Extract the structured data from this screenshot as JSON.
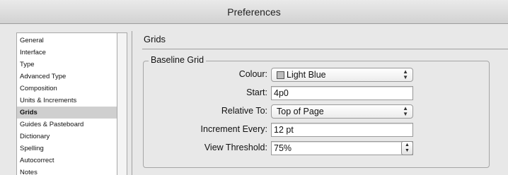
{
  "window": {
    "title": "Preferences"
  },
  "sidebar": {
    "items": [
      {
        "label": "General"
      },
      {
        "label": "Interface"
      },
      {
        "label": "Type"
      },
      {
        "label": "Advanced Type"
      },
      {
        "label": "Composition"
      },
      {
        "label": "Units & Increments"
      },
      {
        "label": "Grids",
        "selected": true
      },
      {
        "label": "Guides & Pasteboard"
      },
      {
        "label": "Dictionary"
      },
      {
        "label": "Spelling"
      },
      {
        "label": "Autocorrect"
      },
      {
        "label": "Notes"
      }
    ]
  },
  "main": {
    "section_title": "Grids",
    "group_title": "Baseline Grid",
    "colour": {
      "label": "Colour:",
      "value": "Light Blue",
      "swatch_color": "#bdbdbd"
    },
    "start": {
      "label": "Start:",
      "value": "4p0"
    },
    "relative_to": {
      "label": "Relative To:",
      "value": "Top of Page"
    },
    "increment_every": {
      "label": "Increment Every:",
      "value": "12 pt"
    },
    "view_threshold": {
      "label": "View Threshold:",
      "value": "75%"
    }
  }
}
